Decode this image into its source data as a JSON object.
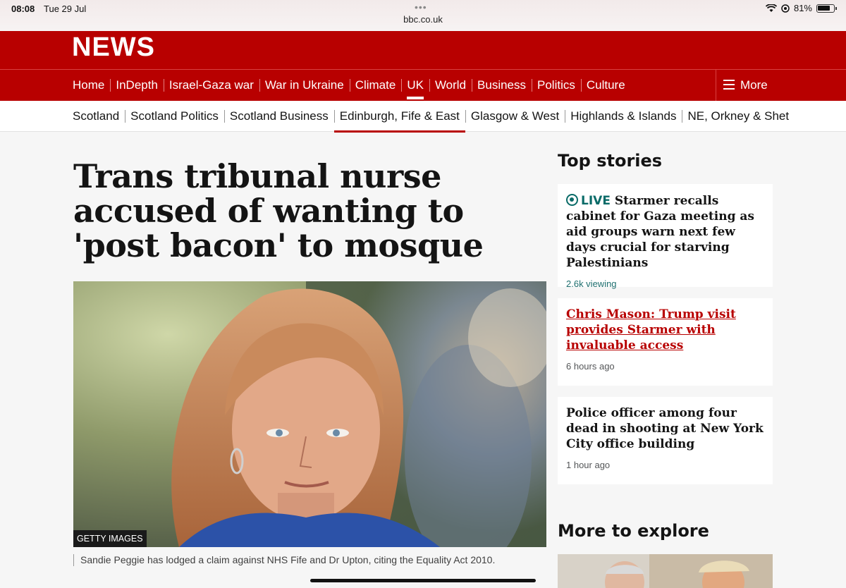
{
  "statusbar": {
    "time": "08:08",
    "date": "Tue 29 Jul",
    "url": "bbc.co.uk",
    "battery": "81%"
  },
  "masthead": {
    "logo": "NEWS"
  },
  "primary_nav": {
    "items": [
      "Home",
      "InDepth",
      "Israel-Gaza war",
      "War in Ukraine",
      "Climate",
      "UK",
      "World",
      "Business",
      "Politics",
      "Culture"
    ],
    "active": "UK",
    "more_label": "More"
  },
  "sub_nav": {
    "items": [
      "Scotland",
      "Scotland Politics",
      "Scotland Business",
      "Edinburgh, Fife & East",
      "Glasgow & West",
      "Highlands & Islands",
      "NE, Orkney & Shet"
    ],
    "active": "Edinburgh, Fife & East"
  },
  "article": {
    "headline": "Trans tribunal nurse accused of wanting to 'post bacon' to mosque",
    "image_credit": "GETTY IMAGES",
    "caption": "Sandie Peggie has lodged a claim against NHS Fife and Dr Upton, citing the Equality Act 2010."
  },
  "top_stories": {
    "title": "Top stories",
    "items": [
      {
        "badge": "LIVE",
        "title": "Starmer recalls cabinet for Gaza meeting as aid groups warn next few days crucial for starving Palestinians",
        "meta": "2.6k viewing"
      },
      {
        "title": "Chris Mason: Trump visit provides Starmer with invaluable access",
        "meta": "6 hours ago"
      },
      {
        "title": "Police officer among four dead in shooting at New York City office building",
        "meta": "1 hour ago"
      }
    ]
  },
  "more_to_explore": {
    "title": "More to explore"
  },
  "colors": {
    "brand_red": "#b80000",
    "live_teal": "#0a6b68",
    "page_bg": "#f6f6f6"
  }
}
